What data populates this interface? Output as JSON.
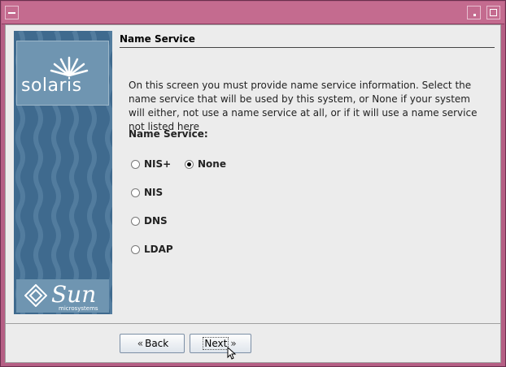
{
  "window": {
    "title": ""
  },
  "sidebar": {
    "brand": "solaris",
    "vendor": "Sun",
    "vendor_sub": "microsystems"
  },
  "page": {
    "section_title": "Name Service",
    "description": "On this screen you must provide name service information.  Select the name service that will be used by this system, or None if your system will either, not use a name service at all, or if it will use a name service not listed here",
    "field_label": "Name Service:"
  },
  "name_service_options": [
    {
      "label": "NIS+",
      "selected": false
    },
    {
      "label": "None",
      "selected": true
    },
    {
      "label": "NIS",
      "selected": false
    },
    {
      "label": "DNS",
      "selected": false
    },
    {
      "label": "LDAP",
      "selected": false
    }
  ],
  "buttons": {
    "back": "Back",
    "next": "Next"
  },
  "colors": {
    "title_bar": "#c46b8f",
    "sidebar": "#3f6a8e",
    "panel": "#ececec"
  }
}
